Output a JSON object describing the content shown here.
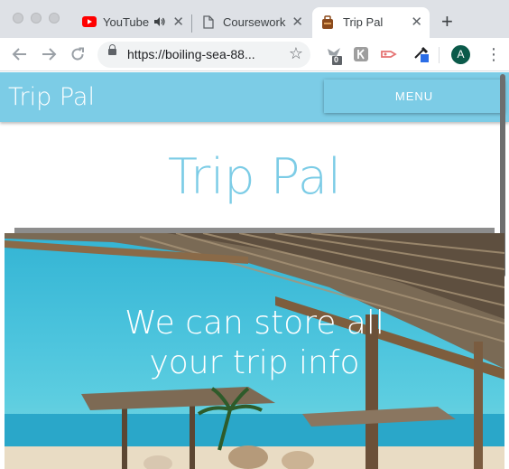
{
  "browser": {
    "tabs": [
      {
        "label": "YouTube",
        "icon": "youtube-icon",
        "audio": true
      },
      {
        "label": "Coursework",
        "icon": "document-icon"
      },
      {
        "label": "Trip Pal",
        "icon": "site-favicon-icon",
        "active": true
      }
    ],
    "close_glyph": "✕",
    "new_tab_glyph": "+",
    "url": "https://boiling-sea-88...",
    "extension_badge": "0",
    "avatar_initial": "A",
    "colors": {
      "tabstrip": "#dee1e6",
      "youtube_red": "#ff0000",
      "avatar": "#0b5a4a"
    }
  },
  "site": {
    "brand": "Trip Pal",
    "menu_label": "MENU",
    "hero_title": "Trip Pal",
    "hero_tagline_line1": "We can store all",
    "hero_tagline_line2": "your trip info",
    "colors": {
      "accent": "#7ccce6",
      "sky": "#33b4d4",
      "text_on_accent": "#ffffff"
    }
  }
}
